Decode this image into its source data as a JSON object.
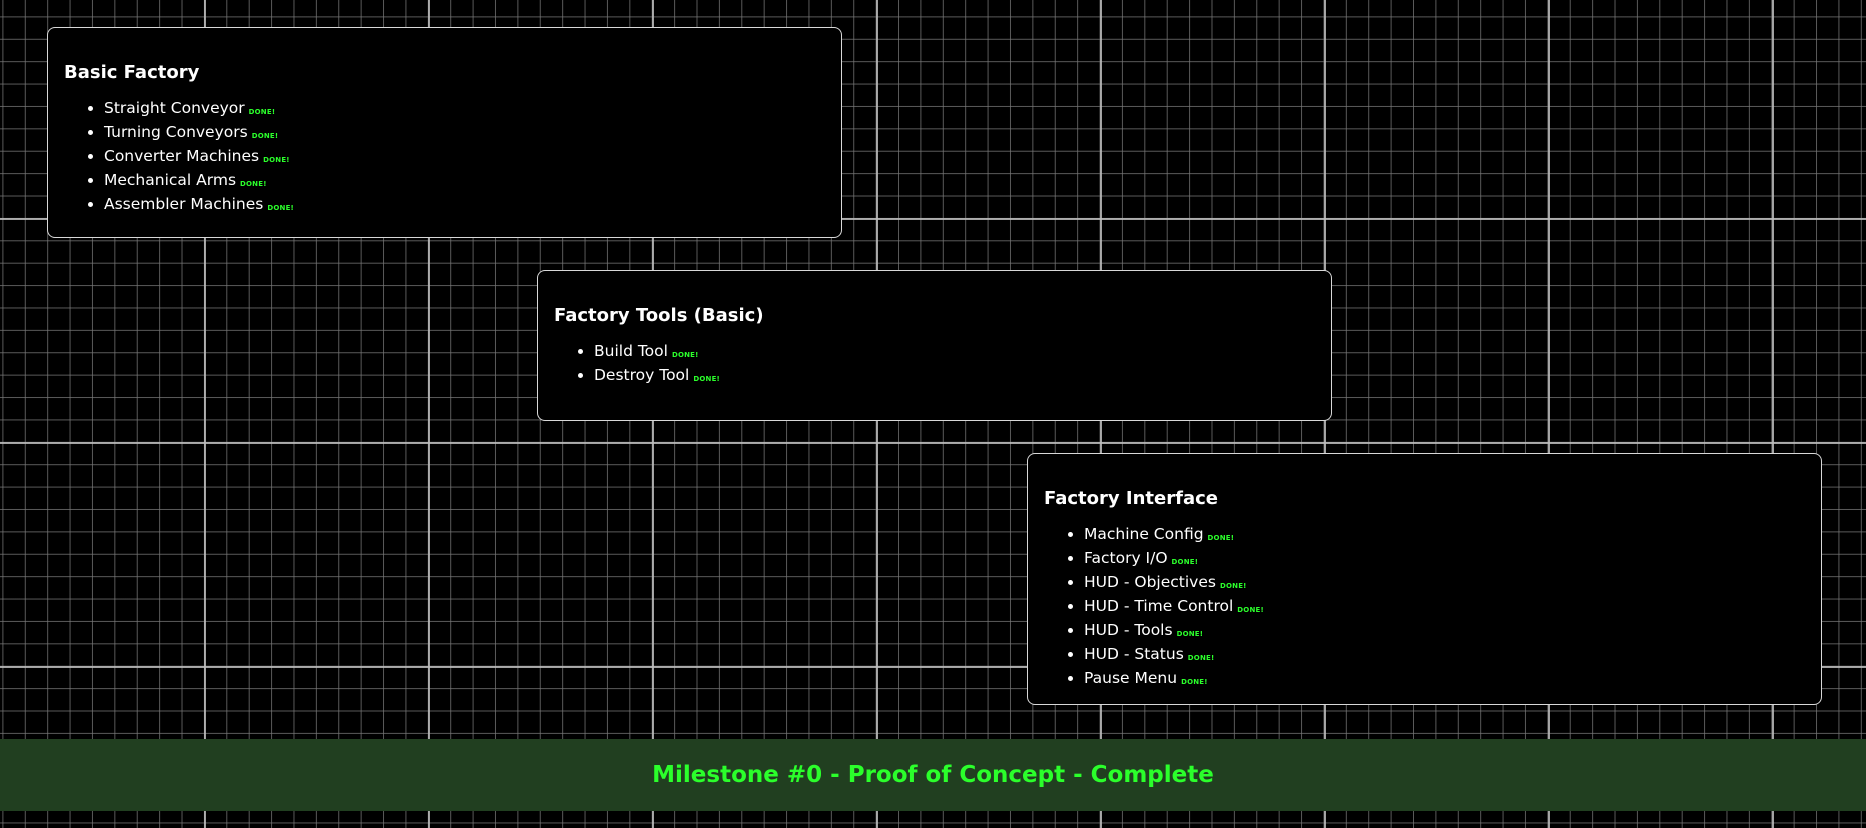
{
  "cards": [
    {
      "title": "Basic Factory",
      "items": [
        {
          "label": "Straight Conveyor",
          "badge": "DONE!"
        },
        {
          "label": "Turning Conveyors",
          "badge": "DONE!"
        },
        {
          "label": "Converter Machines",
          "badge": "DONE!"
        },
        {
          "label": "Mechanical Arms",
          "badge": "DONE!"
        },
        {
          "label": "Assembler Machines",
          "badge": "DONE!"
        }
      ]
    },
    {
      "title": "Factory Tools (Basic)",
      "items": [
        {
          "label": "Build Tool",
          "badge": "DONE!"
        },
        {
          "label": "Destroy Tool",
          "badge": "DONE!"
        }
      ]
    },
    {
      "title": "Factory Interface",
      "items": [
        {
          "label": "Machine Config",
          "badge": "DONE!"
        },
        {
          "label": "Factory I/O",
          "badge": "DONE!"
        },
        {
          "label": "HUD - Objectives",
          "badge": "DONE!"
        },
        {
          "label": "HUD - Time Control",
          "badge": "DONE!"
        },
        {
          "label": "HUD - Tools",
          "badge": "DONE!"
        },
        {
          "label": "HUD - Status",
          "badge": "DONE!"
        },
        {
          "label": "Pause Menu",
          "badge": "DONE!"
        }
      ]
    }
  ],
  "banner": {
    "text": "Milestone #0 - Proof of Concept - Complete"
  },
  "colors": {
    "background": "#000000",
    "grid_major": "#bebebe",
    "grid_minor": "#787878",
    "card_border": "#d8d8d8",
    "done_badge": "#2bff2b",
    "banner_background": "#213f20",
    "banner_text": "#2bff2b"
  }
}
